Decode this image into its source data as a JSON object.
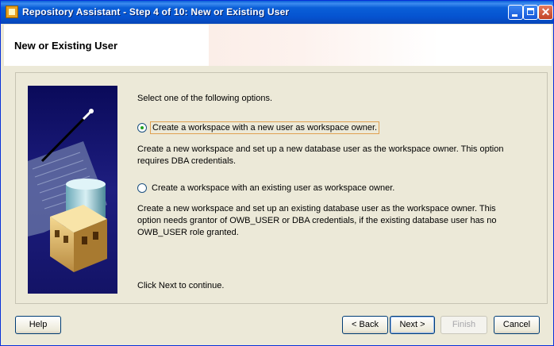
{
  "window": {
    "title": "Repository Assistant - Step 4 of 10: New or Existing User"
  },
  "header": {
    "title": "New or Existing User"
  },
  "content": {
    "intro": "Select one of the following options.",
    "options": [
      {
        "label": "Create a workspace with a new user as workspace owner.",
        "description": "Create a new workspace and set up a new database user as the workspace owner. This option requires DBA credentials.",
        "selected": true
      },
      {
        "label": "Create a workspace with an existing user as workspace owner.",
        "description": "Create a new workspace and set up an existing database user as the workspace owner. This option needs grantor of OWB_USER or DBA credentials, if the existing database user has no OWB_USER role granted.",
        "selected": false
      }
    ],
    "footer_note": "Click Next to continue."
  },
  "buttons": {
    "help": "Help",
    "back": "< Back",
    "next": "Next >",
    "finish": "Finish",
    "cancel": "Cancel"
  },
  "icons": {
    "app": "app-icon",
    "minimize": "minimize-icon",
    "maximize": "maximize-icon",
    "close": "close-icon"
  }
}
